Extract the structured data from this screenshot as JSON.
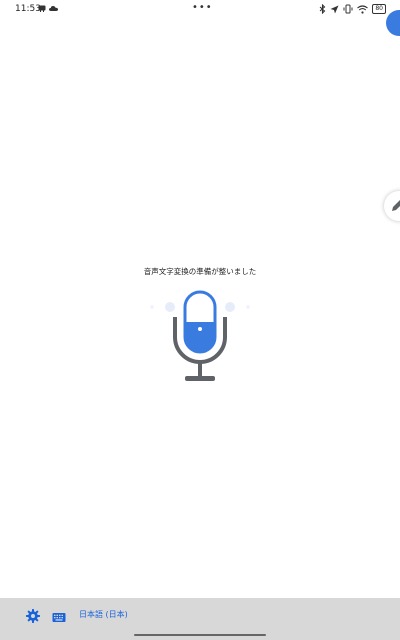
{
  "status_bar": {
    "time": "11:53",
    "battery": "80",
    "more_dots": "•••",
    "left_icons": [
      "notification-icon",
      "cloud-icon"
    ],
    "right_icons": [
      "bluetooth-icon",
      "location-icon",
      "vibrate-icon",
      "wifi-icon",
      "battery-icon"
    ]
  },
  "main": {
    "ready_text": "音声文字変換の準備が整いました",
    "mic_icon": "microphone-icon"
  },
  "bottom_bar": {
    "settings_icon": "gear-icon",
    "keyboard_icon": "keyboard-icon",
    "language_label": "日本語 (日本)"
  },
  "colors": {
    "accent": "#3a7be0",
    "language_text": "#1a62d9",
    "mic_stand": "#5f6368",
    "bottom_bar_bg": "#d8d8d8"
  }
}
